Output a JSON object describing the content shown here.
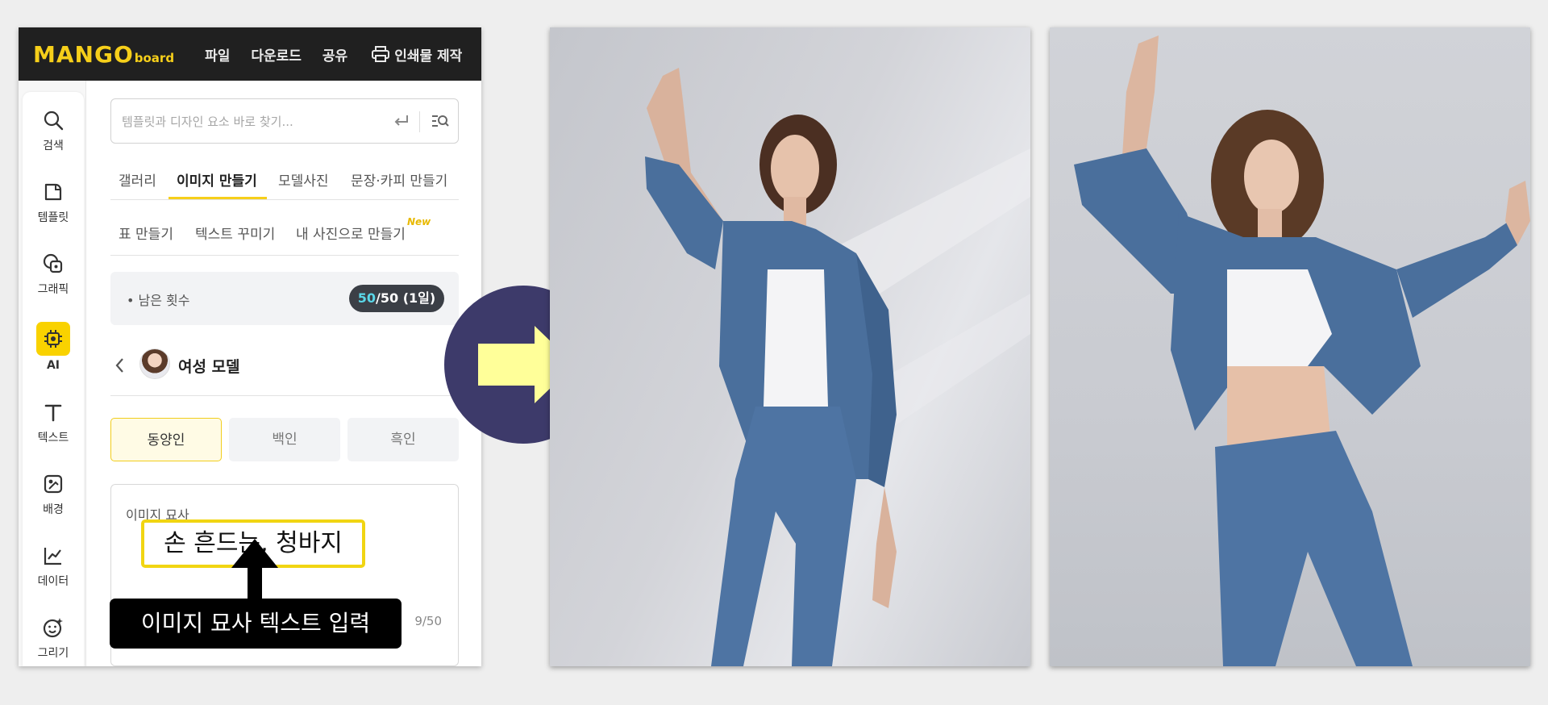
{
  "app": {
    "logo_main": "MANGO",
    "logo_sub": "board",
    "menu": [
      "파일",
      "다운로드",
      "공유"
    ],
    "print_label": "인쇄물 제작"
  },
  "sidebar": {
    "items": [
      {
        "label": "검색",
        "icon": "search-icon"
      },
      {
        "label": "템플릿",
        "icon": "template-icon"
      },
      {
        "label": "그래픽",
        "icon": "graphic-icon"
      },
      {
        "label": "AI",
        "icon": "ai-chip-icon"
      },
      {
        "label": "텍스트",
        "icon": "text-icon"
      },
      {
        "label": "배경",
        "icon": "background-icon"
      },
      {
        "label": "데이터",
        "icon": "chart-line-icon"
      },
      {
        "label": "그리기",
        "icon": "draw-face-icon"
      }
    ]
  },
  "search": {
    "placeholder": "템플릿과 디자인 요소 바로 찾기..."
  },
  "tabs": {
    "row1": [
      "갤러리",
      "이미지 만들기",
      "모델사진",
      "문장·카피 만들기"
    ],
    "row2": [
      "표 만들기",
      "텍스트 꾸미기",
      "내 사진으로 만들기"
    ],
    "new_badge": "New"
  },
  "remain": {
    "label": "• 남은 횟수",
    "used": "50",
    "rest": "/50 (1일)"
  },
  "model": {
    "title": "여성 모델"
  },
  "ethnicity": {
    "options": [
      "동양인",
      "백인",
      "흑인"
    ]
  },
  "description": {
    "label": "이미지 묘사",
    "value": "손 흔드는, 청바지",
    "counter": "9/50"
  },
  "callout": {
    "text": "이미지 묘사 텍스트 입력"
  },
  "colors": {
    "accent": "#f6cf1a",
    "topbar": "#202020",
    "circle": "#3d3a6a",
    "arrow": "#ffff99",
    "denim": "#4a6f9c"
  }
}
